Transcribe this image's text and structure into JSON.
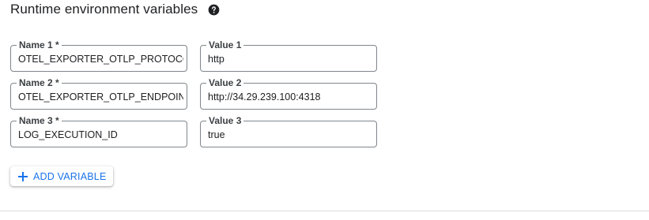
{
  "section": {
    "title": "Runtime environment variables",
    "help_icon": "help-circle-icon"
  },
  "variables": [
    {
      "name_label": "Name 1 *",
      "name_value": "OTEL_EXPORTER_OTLP_PROTOCOL",
      "value_label": "Value 1",
      "value_value": "http"
    },
    {
      "name_label": "Name 2 *",
      "name_value": "OTEL_EXPORTER_OTLP_ENDPOINT",
      "value_label": "Value 2",
      "value_value": "http://34.29.239.100:4318"
    },
    {
      "name_label": "Name 3 *",
      "name_value": "LOG_EXECUTION_ID",
      "value_label": "Value 3",
      "value_value": "true"
    }
  ],
  "add_button": {
    "label": "ADD VARIABLE",
    "icon": "plus-icon"
  },
  "colors": {
    "accent": "#1a73e8",
    "border": "#80868b",
    "text": "#202124"
  }
}
